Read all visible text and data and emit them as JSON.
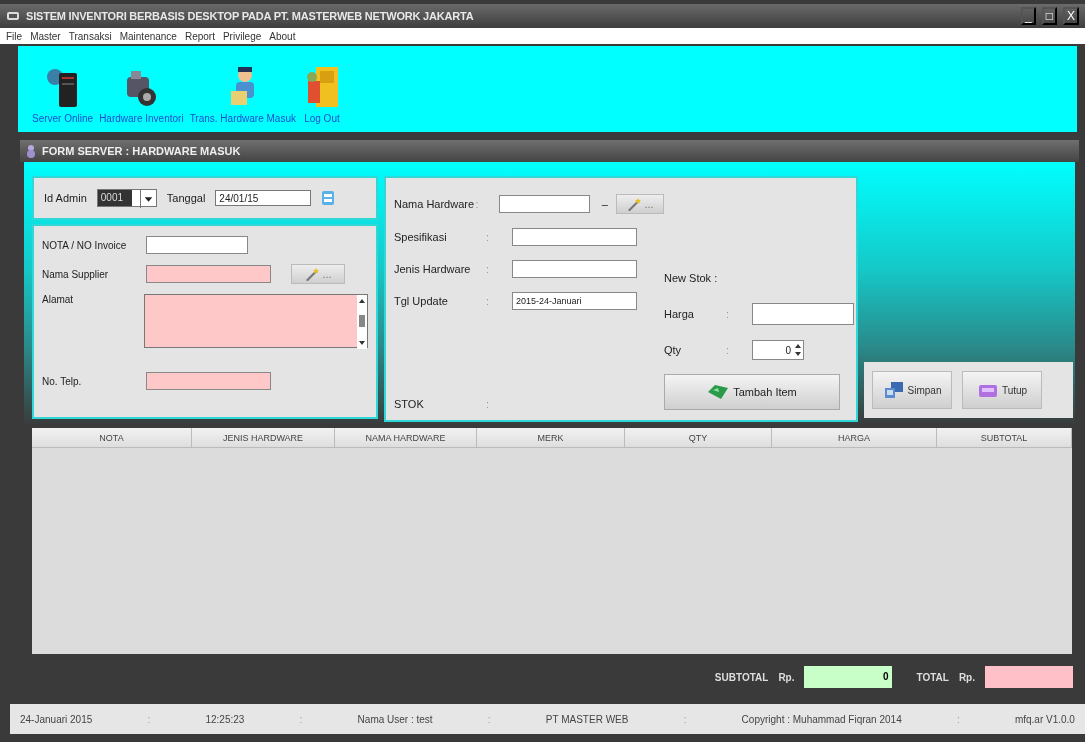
{
  "window": {
    "title": "SISTEM INVENTORI BERBASIS DESKTOP PADA PT. MASTERWEB NETWORK JAKARTA",
    "controls": [
      "_",
      "□",
      "X"
    ]
  },
  "menu": [
    "File",
    "Master",
    "Transaksi",
    "Maintenance",
    "Report",
    "Privilege",
    "About"
  ],
  "toolbar": [
    {
      "label": "Server Online",
      "kind": "server"
    },
    {
      "label": "Hardware Inventori",
      "kind": "device"
    },
    {
      "label": "Trans. Hardware Masuk",
      "kind": "person"
    },
    {
      "label": "Log Out",
      "kind": "door"
    }
  ],
  "form": {
    "title": "FORM SERVER : HARDWARE MASUK",
    "header": {
      "id_admin": {
        "label": "Id Admin",
        "value": "0001",
        "highlighted": true
      },
      "tanggal": {
        "label": "Tanggal",
        "value": "24/01/15"
      }
    },
    "supplier_fields": [
      {
        "label": "NOTA / NO Invoice",
        "kind": "text",
        "color": "#ffffff"
      },
      {
        "label": "Nama Supplier",
        "kind": "lookup",
        "color": "#ffc8c8",
        "button": "..."
      },
      {
        "label": "Alamat",
        "kind": "textarea",
        "color": "#ffc8c8"
      },
      {
        "label": "No. Telp.",
        "kind": "text",
        "color": "#ffc8c8"
      }
    ],
    "hardware_fields": [
      {
        "label": "Nama Hardware",
        "sep": ":",
        "kind": "lookup",
        "dash": "–",
        "button": "..."
      },
      {
        "label": "Spesifikasi",
        "sep": ":",
        "kind": "text"
      },
      {
        "label": "Jenis Hardware",
        "sep": ":",
        "kind": "text"
      },
      {
        "label": "Tgl Update",
        "sep": ":",
        "kind": "text",
        "value": "2015-24-Januari"
      },
      {
        "label": "STOK",
        "sep": ":",
        "kind": "plain"
      }
    ],
    "price_fields": [
      {
        "label": "New Stok :",
        "kind": "plain"
      },
      {
        "label": "Harga",
        "sep": ":",
        "kind": "text"
      },
      {
        "label": "Qty",
        "sep": ":",
        "kind": "spinner",
        "value": "0"
      }
    ],
    "add_button": "Tambah Item",
    "actions": [
      {
        "label": "Simpan",
        "kind": "save"
      },
      {
        "label": "Tutup",
        "kind": "close"
      }
    ]
  },
  "table": {
    "columns": [
      "NOTA",
      "JENIS HARDWARE",
      "NAMA HARDWARE",
      "MERK",
      "QTY",
      "HARGA",
      "SUBTOTAL"
    ]
  },
  "totals": [
    {
      "label": "SUBTOTAL",
      "currency": "Rp.",
      "value": "0",
      "color": "#c8ffc8"
    },
    {
      "label": "TOTAL",
      "currency": "Rp.",
      "color": "#ffc0c8"
    }
  ],
  "status_bar": [
    "24-Januari 2015",
    ":",
    "12:25:23",
    ":",
    "Nama User : test",
    ":",
    "PT MASTER WEB",
    ":",
    "Copyright : Muhammad Fiqran 2014",
    ":",
    "mfq.ar V1.0.0"
  ]
}
